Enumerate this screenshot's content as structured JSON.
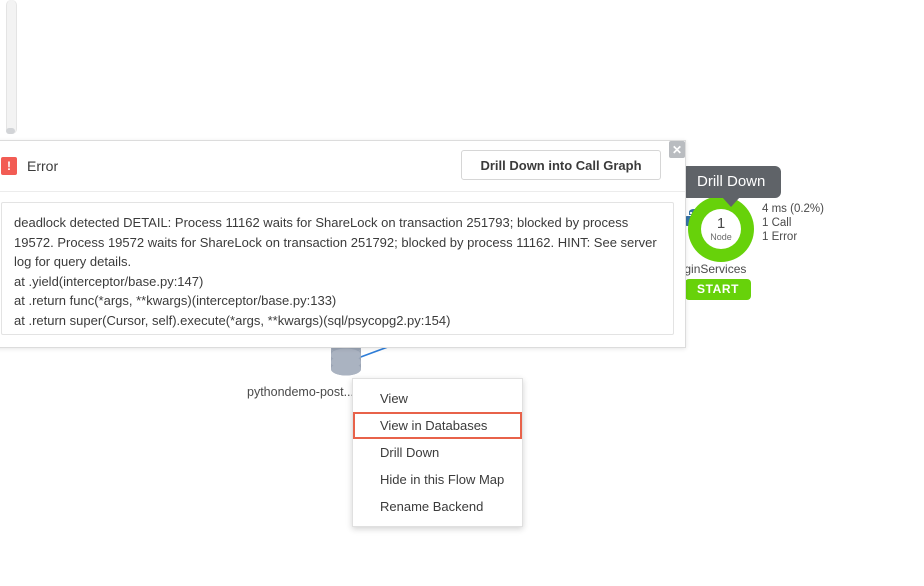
{
  "flow_map": {
    "backend_node": {
      "icon": "database-cylinder-icon",
      "label": "pythondemo-post..."
    },
    "tier_node": {
      "icon": "python-logo-icon",
      "donut_count": "1",
      "donut_unit": "Node",
      "label": "LoginServices",
      "start_badge": "START",
      "metrics": [
        "4 ms (0.2%)",
        "1 Call",
        "1 Error"
      ],
      "accent_color": "#67d20a"
    },
    "tooltip": {
      "text": "Drill Down",
      "background": "#5f6368"
    }
  },
  "error_modal": {
    "icon": "error-exclamation-icon",
    "icon_glyph": "!",
    "icon_color": "#f25c54",
    "title": "Error",
    "drill_down_button": "Drill Down into Call Graph",
    "close_glyph": "✕",
    "message": "deadlock detected DETAIL: Process 11162 waits for ShareLock on transaction 251793; blocked by process 19572. Process 19572 waits for ShareLock on transaction 251792; blocked by process 11162. HINT: See server log for query details.",
    "stack_trace": [
      "at .yield(interceptor/base.py:147)",
      "at .return func(*args, **kwargs)(interceptor/base.py:133)",
      "at .return super(Cursor, self).execute(*args, **kwargs)(sql/psycopg2.py:154)"
    ]
  },
  "context_menu": {
    "highlight_color": "#e8624a",
    "items": [
      {
        "label": "View",
        "highlighted": false
      },
      {
        "label": "View in Databases",
        "highlighted": true
      },
      {
        "label": "Drill Down",
        "highlighted": false
      },
      {
        "label": "Hide in this Flow Map",
        "highlighted": false
      },
      {
        "label": "Rename Backend",
        "highlighted": false
      }
    ]
  }
}
